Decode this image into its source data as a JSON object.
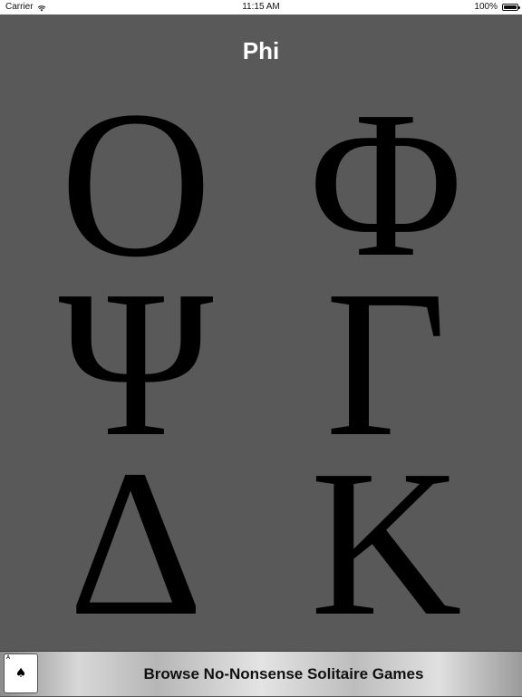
{
  "status_bar": {
    "carrier": "Carrier",
    "wifi_icon": "wifi-icon",
    "time": "11:15 AM",
    "battery_percent": "100%",
    "battery_level": 1.0
  },
  "title": "Phi",
  "letters": {
    "row1_left": "Ο",
    "row1_right": "Φ",
    "row2_left": "Ψ",
    "row2_right": "Γ",
    "row3_left": "Δ",
    "row3_right": "Κ"
  },
  "banner": {
    "text": "Browse No-Nonsense Solitaire Games",
    "card_corner": "A",
    "card_suit": "♠",
    "card_icon": "playing-card-icon"
  },
  "colors": {
    "background": "#595959",
    "letters": "#000000",
    "title": "#ffffff"
  }
}
